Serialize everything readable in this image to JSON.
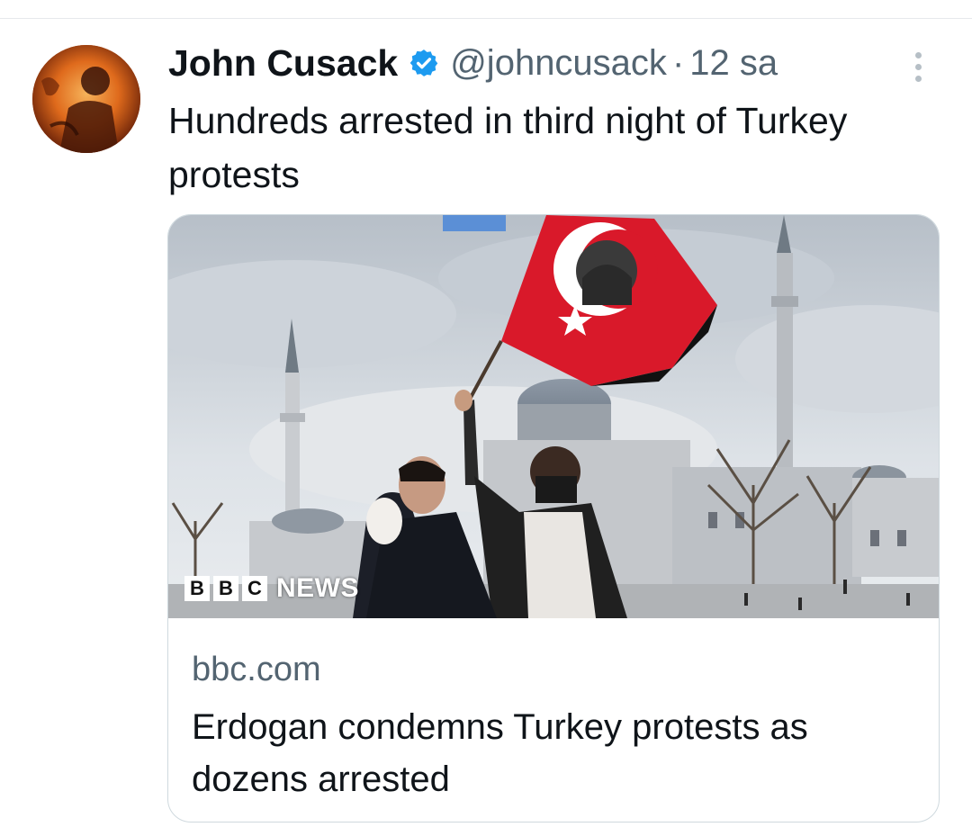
{
  "tweet": {
    "display_name": "John Cusack",
    "handle": "@johncusack",
    "separator": "·",
    "time": "12 sa",
    "text": "Hundreds arrested in third night of Turkey protests",
    "verified_color": "#1d9bf0"
  },
  "card": {
    "logo_letters": [
      "B",
      "B",
      "C"
    ],
    "logo_word": "NEWS",
    "domain": "bbc.com",
    "title": "Erdogan condemns Turkey protests as dozens arrested"
  },
  "icons": {
    "verified": "verified-badge-icon",
    "more": "more-vertical-icon"
  },
  "colors": {
    "text_primary": "#0f1419",
    "text_secondary": "#536471",
    "border": "#cfd9de",
    "flag_red": "#d9192a"
  }
}
